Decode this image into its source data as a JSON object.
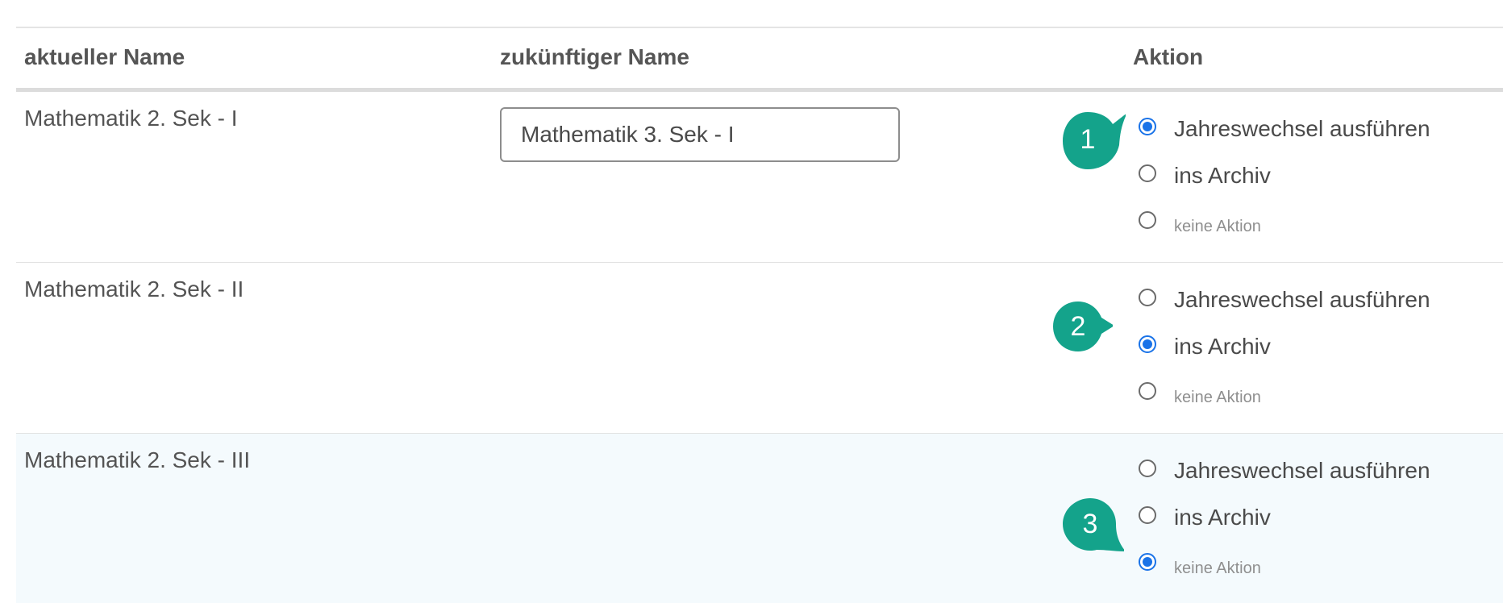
{
  "table": {
    "headers": {
      "current_name": "aktueller Name",
      "future_name": "zukünftiger Name",
      "action": "Aktion"
    },
    "rows": [
      {
        "current_name": "Mathematik 2. Sek - I",
        "future_name": "Mathematik 3. Sek - I",
        "options": {
          "rollover": "Jahreswechsel ausführen",
          "archive": "ins Archiv",
          "none": "keine Aktion"
        },
        "selected": "rollover",
        "marker": "1"
      },
      {
        "current_name": "Mathematik 2. Sek - II",
        "options": {
          "rollover": "Jahreswechsel ausführen",
          "archive": "ins Archiv",
          "none": "keine Aktion"
        },
        "selected": "archive",
        "marker": "2"
      },
      {
        "current_name": "Mathematik 2. Sek - III",
        "options": {
          "rollover": "Jahreswechsel ausführen",
          "archive": "ins Archiv",
          "none": "keine Aktion"
        },
        "selected": "none",
        "marker": "3"
      }
    ]
  },
  "colors": {
    "radio_checked": "#1a73e8",
    "marker": "#14a38b",
    "highlight_row": "#f4fafd"
  }
}
